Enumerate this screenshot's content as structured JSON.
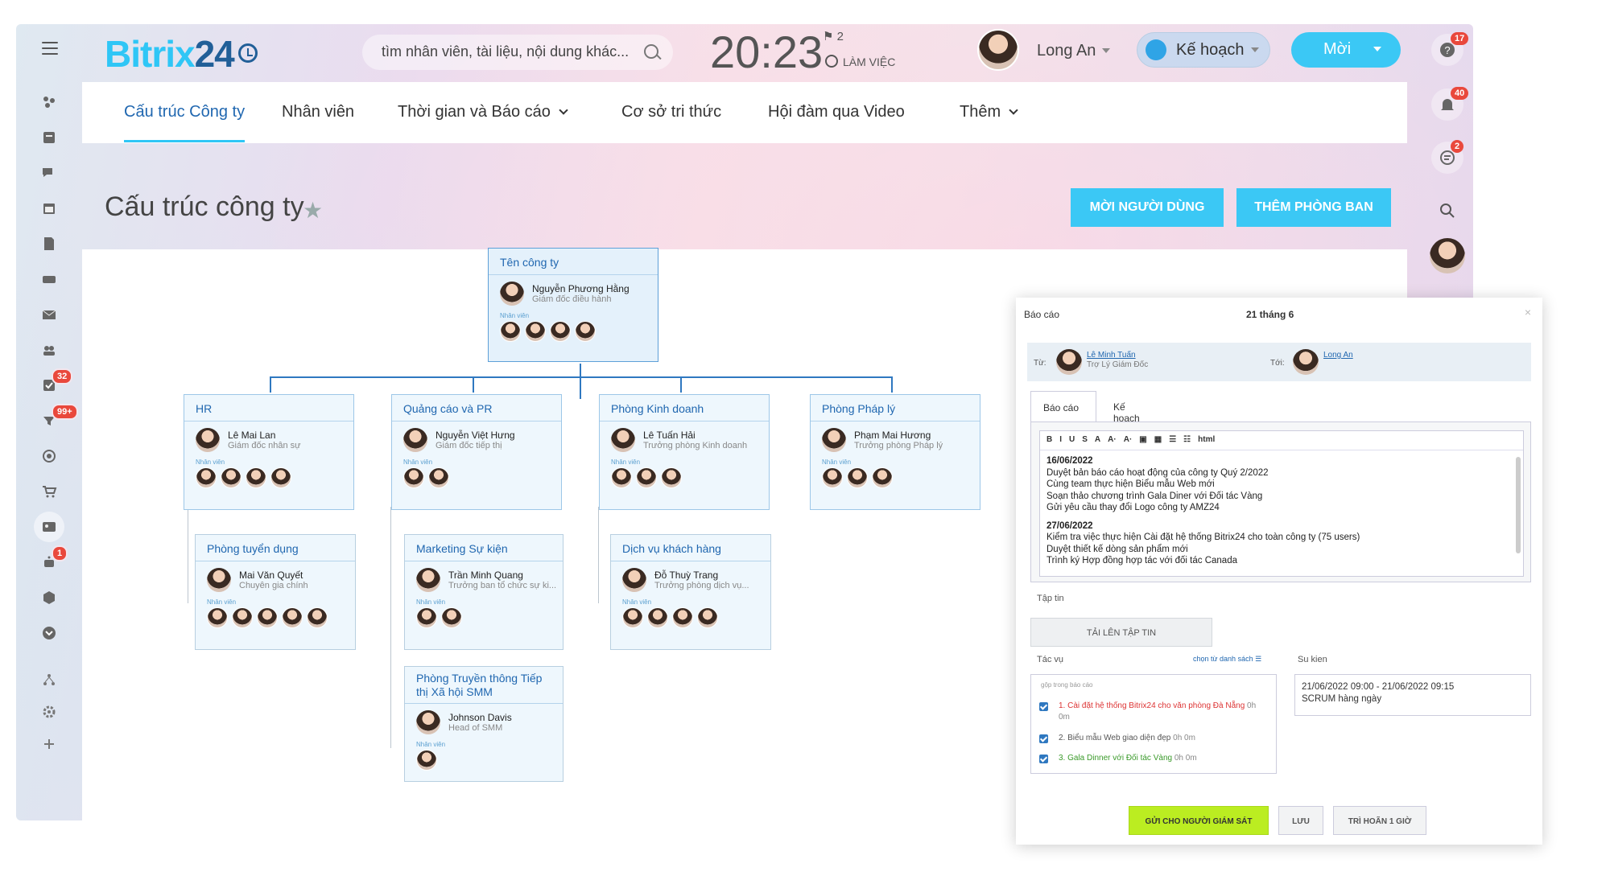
{
  "header": {
    "logo_a": "Bitrix",
    "logo_b": "24",
    "search_placeholder": "tìm nhân viên, tài liệu, nội dung khác...",
    "time": "20:23",
    "flag_count": "2",
    "work_status": "LÀM VIỆC",
    "user_name": "Long An",
    "plan_label": "Kế hoạch",
    "invite_label": "Mời"
  },
  "left_badges": {
    "tasks": "32",
    "feed": "99+",
    "robots": "1"
  },
  "right_badges": {
    "help": "17",
    "notifications": "40",
    "chat": "2"
  },
  "nav": {
    "items": [
      "Cấu trúc Công ty",
      "Nhân viên",
      "Thời gian và Báo cáo",
      "Cơ sở tri thức",
      "Hội đàm qua Video",
      "Thêm"
    ]
  },
  "page": {
    "title": "Cấu trúc công ty",
    "invite_user": "MỜI NGƯỜI DÙNG",
    "add_dept": "THÊM PHÒNG BAN"
  },
  "org": {
    "emp_label": "Nhân viên",
    "root": {
      "title": "Tên công ty",
      "name": "Nguyễn Phương Hằng",
      "pos": "Giám đốc điều hành"
    },
    "depts": [
      {
        "title": "HR",
        "name": "Lê Mai Lan",
        "pos": "Giám đốc nhân sự"
      },
      {
        "title": "Quảng cáo và PR",
        "name": "Nguyễn Việt Hưng",
        "pos": "Giám đốc tiếp thị"
      },
      {
        "title": "Phòng Kinh doanh",
        "name": "Lê Tuấn Hải",
        "pos": "Trưởng phòng Kinh doanh"
      },
      {
        "title": "Phòng Pháp lý",
        "name": "Phạm Mai Hương",
        "pos": "Trưởng phòng Pháp lý"
      }
    ],
    "subs": [
      {
        "title": "Phòng tuyển dụng",
        "name": "Mai Văn Quyết",
        "pos": "Chuyên gia chính"
      },
      {
        "title": "Marketing Sự kiện",
        "name": "Trần Minh Quang",
        "pos": "Trưởng ban tổ chức sự ki..."
      },
      {
        "title": "Dịch vụ khách hàng",
        "name": "Đỗ Thuỳ Trang",
        "pos": "Trưởng phòng dịch vụ..."
      },
      {
        "title": "Phòng Truyền thông Tiếp thị Xã hội SMM",
        "name": "Johnson Davis",
        "pos": "Head of SMM"
      }
    ]
  },
  "report": {
    "title": "Báo cáo",
    "date": "21 tháng 6",
    "close": "×",
    "from_label": "Từ:",
    "from_name": "Lê Minh Tuấn",
    "from_role": "Trợ Lý Giám Đốc",
    "to_label": "Tới:",
    "to_name": "Long An",
    "tab_report": "Báo cáo",
    "tab_plan": "Kế hoạch",
    "toolbar": [
      "B",
      "I",
      "U",
      "S",
      "A",
      "A·",
      "A·",
      "html"
    ],
    "lines": [
      "16/06/2022",
      "Duyệt bản báo cáo hoạt động của công ty Quý 2/2022",
      "Cùng team thực hiện Biểu mẫu Web mới",
      "Soạn thảo chương trình Gala Diner với Đối tác Vàng",
      "Gửi yêu cầu thay đổi Logo công ty AMZ24",
      "",
      "27/06/2022",
      "Kiểm tra việc thực hiện Cài đặt hệ thống Bitrix24 cho toàn công ty (75 users)",
      "Duyệt thiết kế dòng sản phẩm mới",
      "Trình ký Hợp đồng hợp tác với đối tác Canada"
    ],
    "files_label": "Tập tin",
    "upload": "TẢI LÊN TẬP TIN",
    "tasks_label": "Tác vụ",
    "choose_list": "chọn từ danh sách",
    "events_label": "Su kien",
    "tasks_hint": "gộp trong báo cáo",
    "tasks": [
      {
        "text": "1. Cài đặt hệ thống Bitrix24 cho văn phòng Đà Nẵng",
        "time": "0h 0m",
        "color": "#d33"
      },
      {
        "text": "2. Biểu mẫu Web giao diện đẹp",
        "time": "0h 0m",
        "color": "#555"
      },
      {
        "text": "3. Gala Dinner với Đối tác Vàng",
        "time": "0h 0m",
        "color": "#3a9a2a"
      }
    ],
    "event_time": "21/06/2022 09:00 - 21/06/2022 09:15",
    "event_name": "SCRUM hàng ngày",
    "btn_send": "GỬI CHO NGƯỜI GIÁM SÁT",
    "btn_save": "LƯU",
    "btn_delay": "TRÌ HOÃN 1 GIỜ"
  }
}
